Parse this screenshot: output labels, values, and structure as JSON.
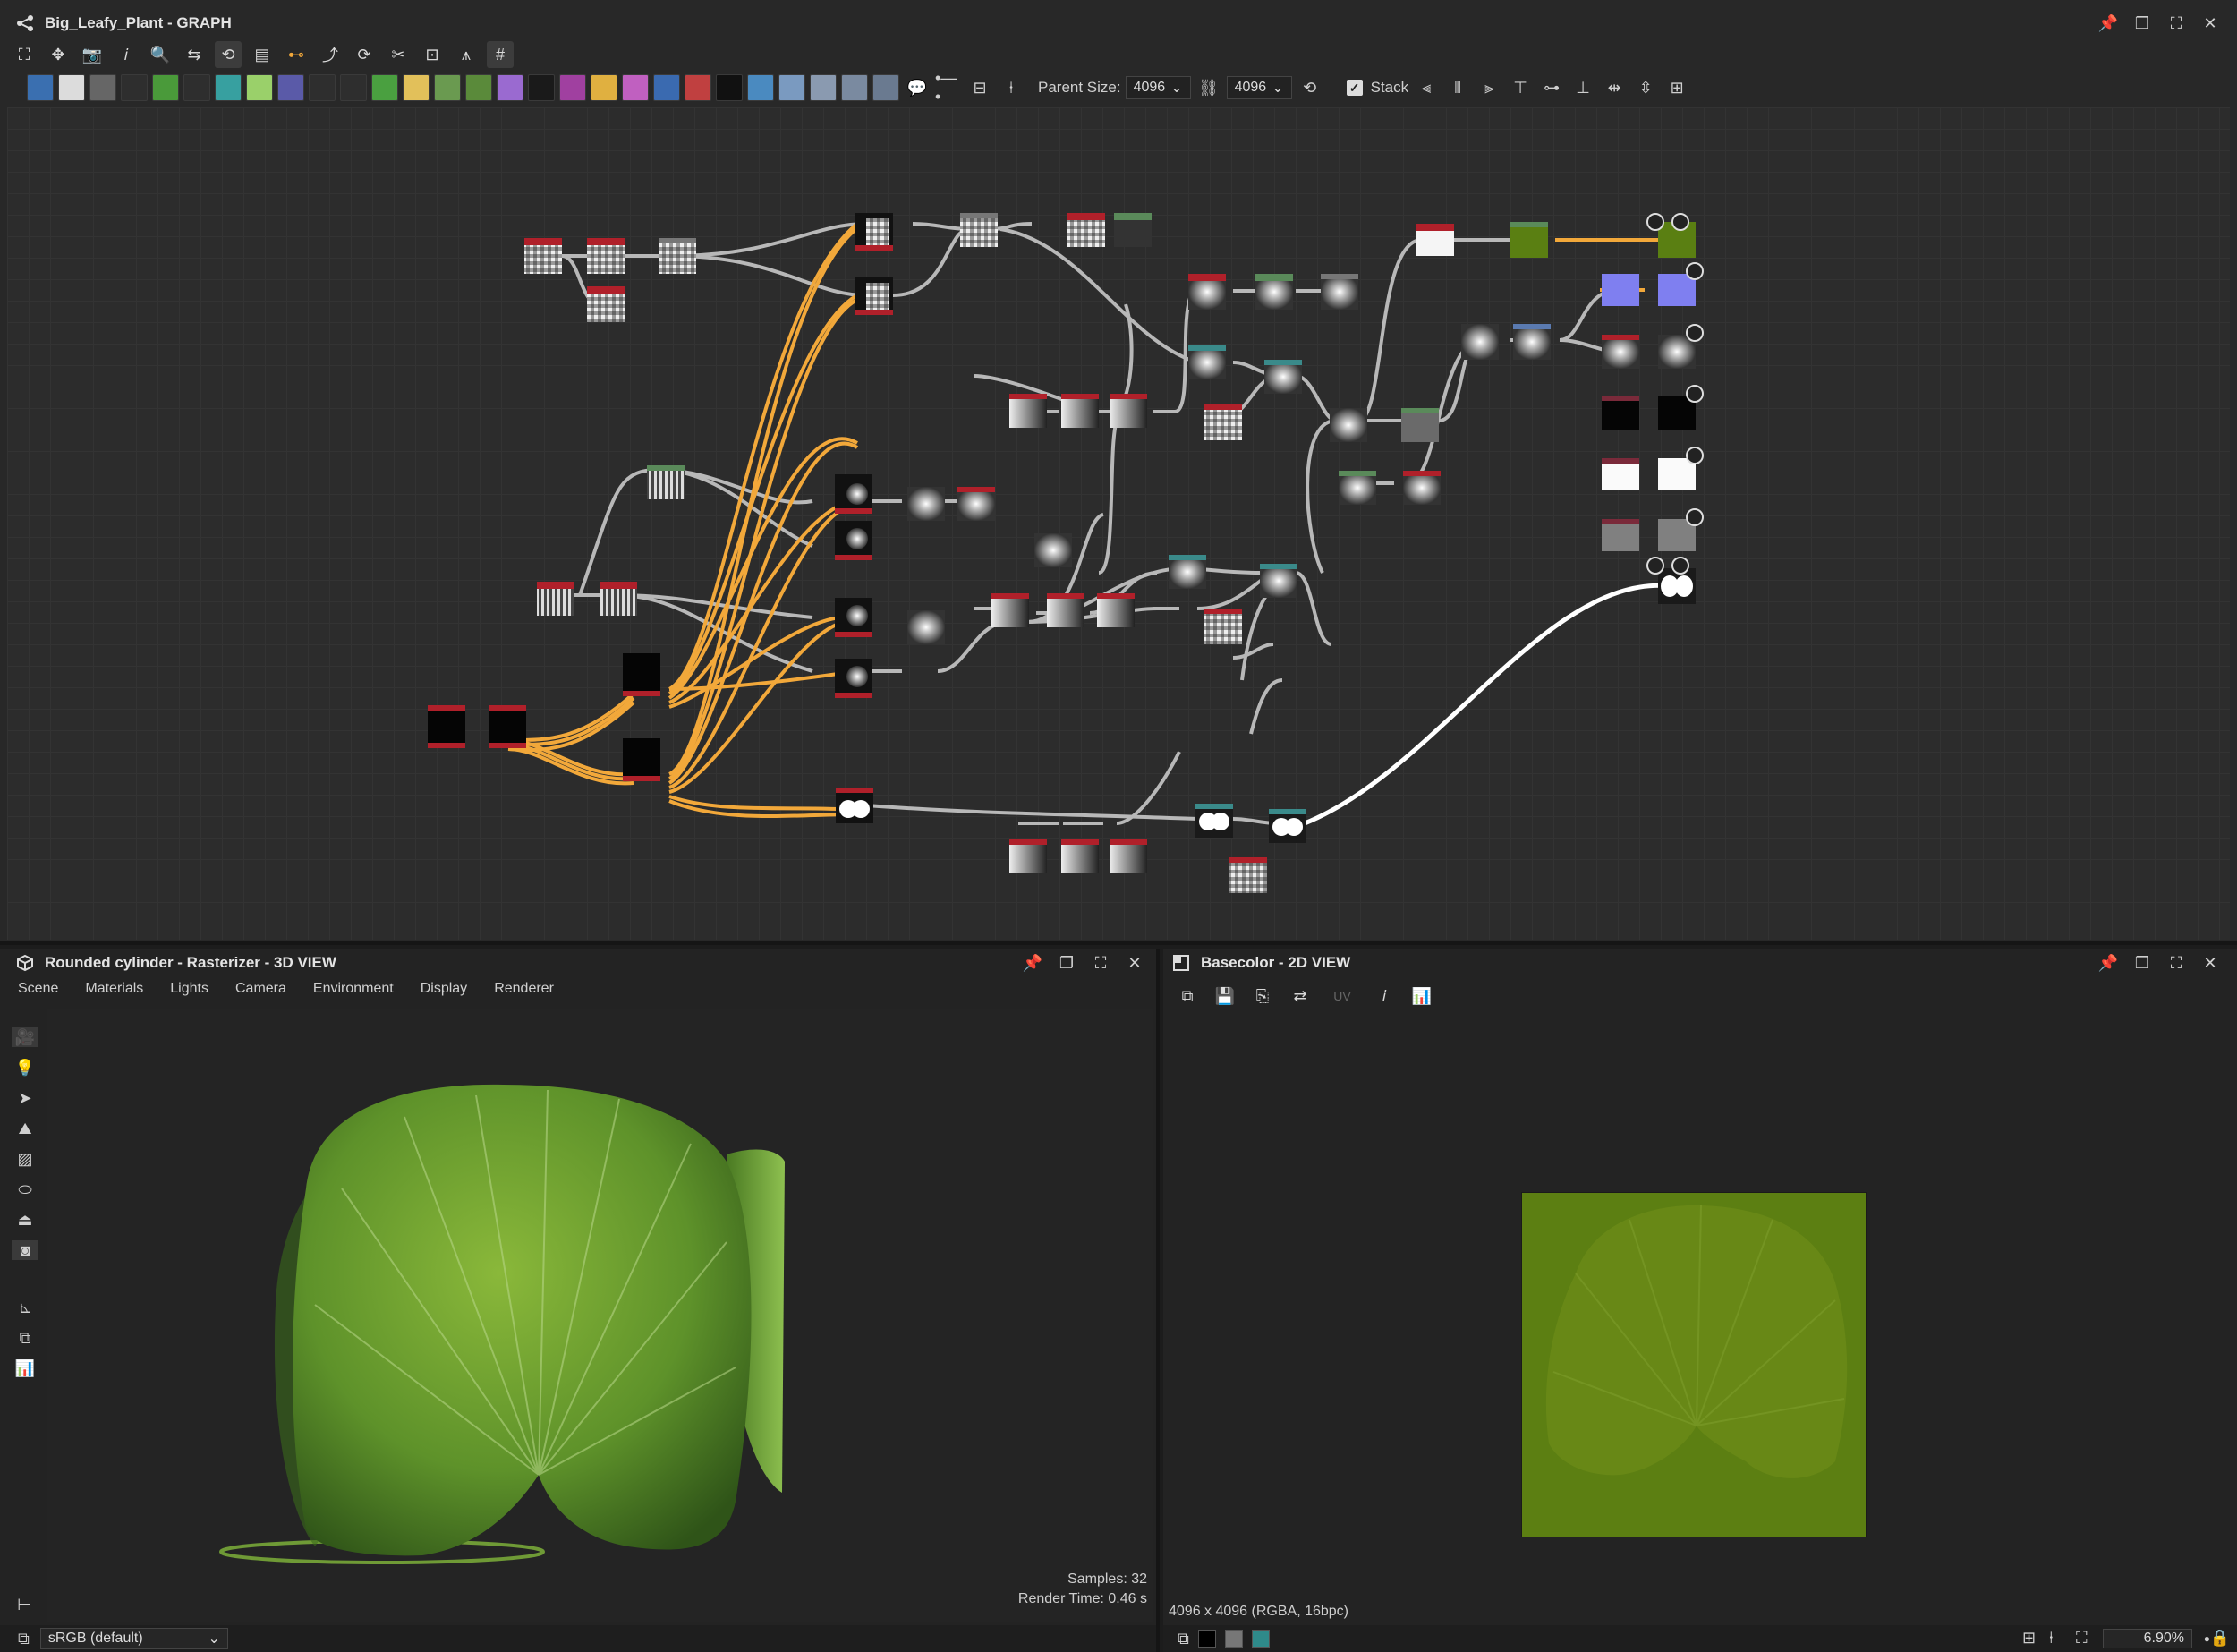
{
  "graph": {
    "title": "Big_Leafy_Plant - GRAPH",
    "parent_size_label": "Parent Size:",
    "parent_size_value": "4096",
    "size_value": "4096",
    "stack_label": "Stack",
    "stack_checked": true
  },
  "view3d": {
    "title": "Rounded cylinder - Rasterizer - 3D VIEW",
    "menu": [
      "Scene",
      "Materials",
      "Lights",
      "Camera",
      "Environment",
      "Display",
      "Renderer"
    ],
    "samples": "Samples: 32",
    "render_time": "Render Time: 0.46 s",
    "color_space": "sRGB (default)"
  },
  "view2d": {
    "title": "Basecolor - 2D VIEW",
    "uv_label": "UV",
    "resolution": "4096 x 4096 (RGBA, 16bpc)",
    "zoom": "6.90%"
  },
  "colors": {
    "wire": "#b8b8b8",
    "wire_selected": "#f2a83a",
    "node_header": "#b0202a",
    "leaf_green": "#5c7f12",
    "normal_blue": "#7f7ff0"
  }
}
